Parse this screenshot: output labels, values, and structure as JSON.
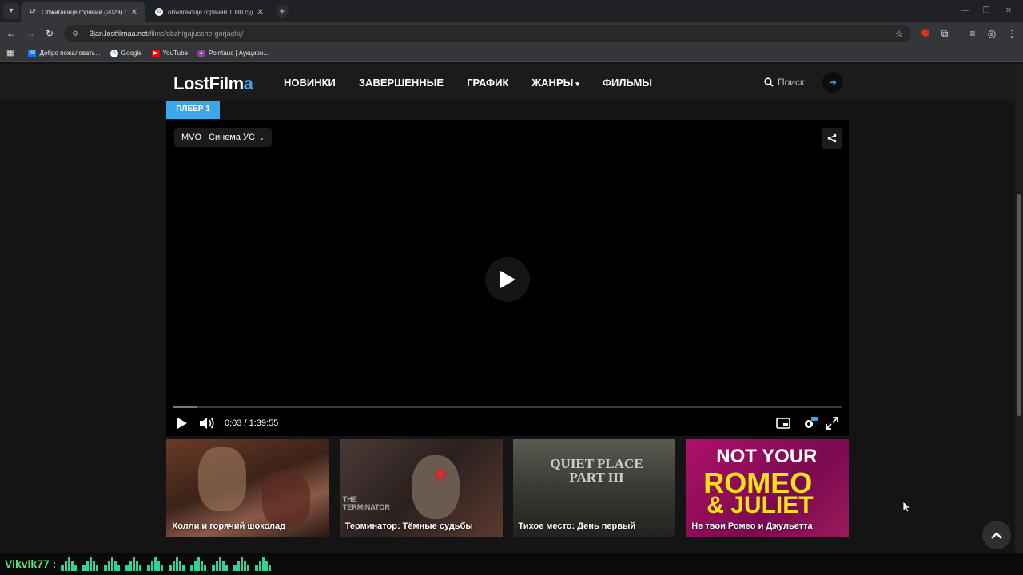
{
  "browser": {
    "tabs": [
      {
        "favicon_text": "LF",
        "title": "Обжигающе горячий (2023) с",
        "active": true
      },
      {
        "favicon_text": "G",
        "title": "обжигающе горячий 1080 суд",
        "active": false
      }
    ],
    "address": {
      "domain": "3jan.lostfilmaa.net",
      "path": "/films/obzhigajusche-gorjachij/"
    },
    "bookmarks": [
      {
        "icon": "vk-icon",
        "label": "Добро пожаловать..."
      },
      {
        "icon": "google-icon",
        "label": "Google"
      },
      {
        "icon": "youtube-icon",
        "label": "YouTube"
      },
      {
        "icon": "pointauc-icon",
        "label": "Pointauc | Аукцион..."
      }
    ]
  },
  "site": {
    "logo_main": "LostFilm",
    "logo_accent": "a",
    "nav": [
      "НОВИНКИ",
      "ЗАВЕРШЕННЫЕ",
      "ГРАФИК",
      "ЖАНРЫ",
      "ФИЛЬМЫ"
    ],
    "search_label": "Поиск",
    "accent_color": "#3ba6e8"
  },
  "player": {
    "tab_label": "ПЛЕЕР 1",
    "voice": "MVO | Синема УС",
    "time_text": "0:03 / 1:39:55",
    "progress_fraction": 0.0005
  },
  "recommendations": [
    {
      "title": "Холли и горячий шоколад"
    },
    {
      "title": "Терминатор: Тёмные судьбы",
      "art_text": "THE TERMINATOR"
    },
    {
      "title": "Тихое место: День первый",
      "art_text": "QUIET PLACE PART III"
    },
    {
      "title": "Не твои Ромео и Джульетта",
      "art_line1": "NOT YOUR",
      "art_line2": "ROMEO",
      "art_line3": "& JULIET"
    }
  ],
  "overlay": {
    "name": "Vikvik77 :"
  }
}
